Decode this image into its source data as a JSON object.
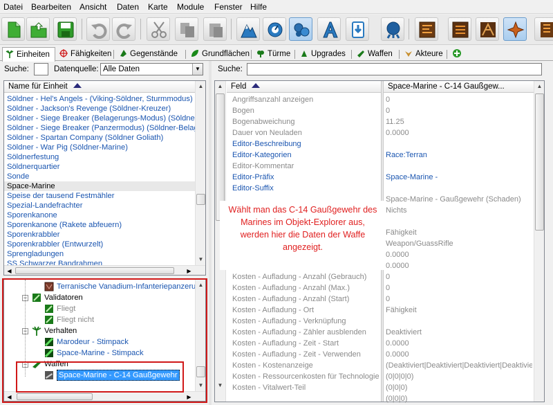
{
  "menu": [
    "Datei",
    "Bearbeiten",
    "Ansicht",
    "Daten",
    "Karte",
    "Module",
    "Fenster",
    "Hilfe"
  ],
  "toolbar": {
    "buttons": [
      "new-file-icon",
      "open-file-icon",
      "save-icon",
      "undo-icon",
      "redo-icon",
      "cut-icon",
      "copy-icon",
      "paste-icon",
      "terrain-icon",
      "triggers-icon",
      "data-icon",
      "text-icon",
      "import-icon",
      "ai-icon",
      "cutscene-icon",
      "layout-icon",
      "units-icon",
      "abilities-icon",
      "extra-icon"
    ]
  },
  "tabs": [
    {
      "label": "Einheiten",
      "icon": "palm-icon"
    },
    {
      "label": "Fähigkeiten",
      "icon": "crosshair-icon"
    },
    {
      "label": "Gegenstände",
      "icon": "item-icon"
    },
    {
      "label": "Grundflächen",
      "icon": "leaf-icon"
    },
    {
      "label": "Türme",
      "icon": "tower-icon"
    },
    {
      "label": "Upgrades",
      "icon": "upgrade-icon"
    },
    {
      "label": "Waffen",
      "icon": "weapon-icon"
    },
    {
      "label": "Akteure",
      "icon": "actor-icon"
    },
    {
      "label": "",
      "icon": "add-icon"
    }
  ],
  "left": {
    "search_label": "Suche:",
    "search_value": "",
    "source_label": "Datenquelle:",
    "source_value": "Alle Daten",
    "column_header": "Name für Einheit",
    "list": [
      "Söldner - Hel's Angels - (Viking-Söldner, Sturmmodus)",
      "Söldner - Jackson's Revenge (Söldner-Kreuzer)",
      "Söldner - Siege Breaker (Belagerungs-Modus) (Söldner-Belagerungspanzer)",
      "Söldner - Siege Breaker (Panzermodus) (Söldner-Belagerungspanzer)",
      "Söldner - Spartan Company (Söldner Goliath)",
      "Söldner - War Pig (Söldner-Marine)",
      "Söldnerfestung",
      "Söldnerquartier",
      "Sonde",
      "Space-Marine",
      "Speise der tausend Festmähler",
      "Spezial-Landefrachter",
      "Sporenkanone",
      "Sporenkanone (Rakete abfeuern)",
      "Sporenkrabbler",
      "Sporenkrabbler (Entwurzelt)",
      "Sprengladungen",
      "SS Schwarzer Bandrahmen"
    ],
    "selected_index": 9,
    "tree": [
      {
        "label": "Terranische Vanadium-Infanteriepanzerung",
        "level": 3,
        "icon": "armor-icon",
        "gray": false
      },
      {
        "label": "Validatoren",
        "level": 2,
        "icon": "validator-icon",
        "gray": false,
        "expander": "−"
      },
      {
        "label": "Fliegt",
        "level": 3,
        "icon": "validator-icon",
        "gray": true
      },
      {
        "label": "Fliegt nicht",
        "level": 3,
        "icon": "validator-icon",
        "gray": true
      },
      {
        "label": "Verhalten",
        "level": 2,
        "icon": "palm-icon",
        "gray": false,
        "expander": "−"
      },
      {
        "label": "Marodeur - Stimpack",
        "level": 3,
        "icon": "stimpack-icon",
        "gray": false
      },
      {
        "label": "Space-Marine - Stimpack",
        "level": 3,
        "icon": "stimpack-icon",
        "gray": false
      },
      {
        "label": "Waffen",
        "level": 2,
        "icon": "weapon-icon",
        "gray": false,
        "expander": "−"
      },
      {
        "label": "Space-Marine - C-14 Gaußgewehr",
        "level": 3,
        "icon": "gun-icon",
        "gray": false,
        "selected": true
      }
    ]
  },
  "right": {
    "search_label": "Suche:",
    "search_value": "",
    "field_header": "Feld",
    "value_header": "Space-Marine - C-14 Gaußgew...",
    "rows": [
      {
        "field": "Angriffsanzahl anzeigen",
        "value": "0",
        "fc": "gray",
        "vc": "gray"
      },
      {
        "field": "Bogen",
        "value": "0",
        "fc": "gray",
        "vc": "gray"
      },
      {
        "field": "Bogenabweichung",
        "value": "11.25",
        "fc": "gray",
        "vc": "gray"
      },
      {
        "field": "Dauer von Neuladen",
        "value": "0.0000",
        "fc": "gray",
        "vc": "gray"
      },
      {
        "field": "Editor-Beschreibung",
        "value": "",
        "fc": "blue",
        "vc": "gray"
      },
      {
        "field": "Editor-Kategorien",
        "value": "Race:Terran",
        "fc": "blue",
        "vc": "blue"
      },
      {
        "field": "Editor-Kommentar",
        "value": "",
        "fc": "gray",
        "vc": "gray"
      },
      {
        "field": "Editor-Präfix",
        "value": "Space-Marine -",
        "fc": "blue",
        "vc": "blue"
      },
      {
        "field": "Editor-Suffix",
        "value": "",
        "fc": "blue",
        "vc": "gray"
      },
      {
        "field": "",
        "value": "Space-Marine - Gaußgewehr (Schaden)",
        "fc": "gray",
        "vc": "gray"
      },
      {
        "field": "",
        "value": "Nichts",
        "fc": "gray",
        "vc": "gray"
      },
      {
        "field": "",
        "value": "",
        "fc": "gray",
        "vc": "gray"
      },
      {
        "field": "",
        "value": "Fähigkeit",
        "fc": "gray",
        "vc": "gray"
      },
      {
        "field": "",
        "value": "Weapon/GuassRifle",
        "fc": "gray",
        "vc": "gray"
      },
      {
        "field": "",
        "value": "0.0000",
        "fc": "gray",
        "vc": "gray"
      },
      {
        "field": "",
        "value": "0.0000",
        "fc": "gray",
        "vc": "gray"
      },
      {
        "field": "Kosten - Aufladung - Anzahl (Gebrauch)",
        "value": "0",
        "fc": "gray",
        "vc": "gray"
      },
      {
        "field": "Kosten - Aufladung - Anzahl (Max.)",
        "value": "0",
        "fc": "gray",
        "vc": "gray"
      },
      {
        "field": "Kosten - Aufladung - Anzahl (Start)",
        "value": "0",
        "fc": "gray",
        "vc": "gray"
      },
      {
        "field": "Kosten - Aufladung - Ort",
        "value": "Fähigkeit",
        "fc": "gray",
        "vc": "gray"
      },
      {
        "field": "Kosten - Aufladung - Verknüpfung",
        "value": "",
        "fc": "gray",
        "vc": "gray"
      },
      {
        "field": "Kosten - Aufladung - Zähler ausblenden",
        "value": "Deaktiviert",
        "fc": "gray",
        "vc": "gray"
      },
      {
        "field": "Kosten - Aufladung - Zeit - Start",
        "value": "0.0000",
        "fc": "gray",
        "vc": "gray"
      },
      {
        "field": "Kosten - Aufladung - Zeit - Verwenden",
        "value": "0.0000",
        "fc": "gray",
        "vc": "gray"
      },
      {
        "field": "Kosten - Kostenanzeige",
        "value": "(Deaktiviert|Deaktiviert|Deaktiviert|Deaktiviert)",
        "fc": "gray",
        "vc": "gray"
      },
      {
        "field": "Kosten - Ressourcenkosten für Technologie",
        "value": "(0|0|0|0)",
        "fc": "gray",
        "vc": "gray"
      },
      {
        "field": "Kosten - Vitalwert-Teil",
        "value": "(0|0|0)",
        "fc": "gray",
        "vc": "gray"
      },
      {
        "field": "",
        "value": "(0|0|0)",
        "fc": "gray",
        "vc": "gray"
      }
    ]
  },
  "annotation": "Wählt man das C-14 Gaußgewehr des Marines im Objekt-Explorer aus, werden hier die Daten der Waffe angezeigt.",
  "colors": {
    "link": "#1a55b0",
    "highlight": "#3399ff",
    "annotation": "#e02020",
    "redbox": "#d01818"
  }
}
